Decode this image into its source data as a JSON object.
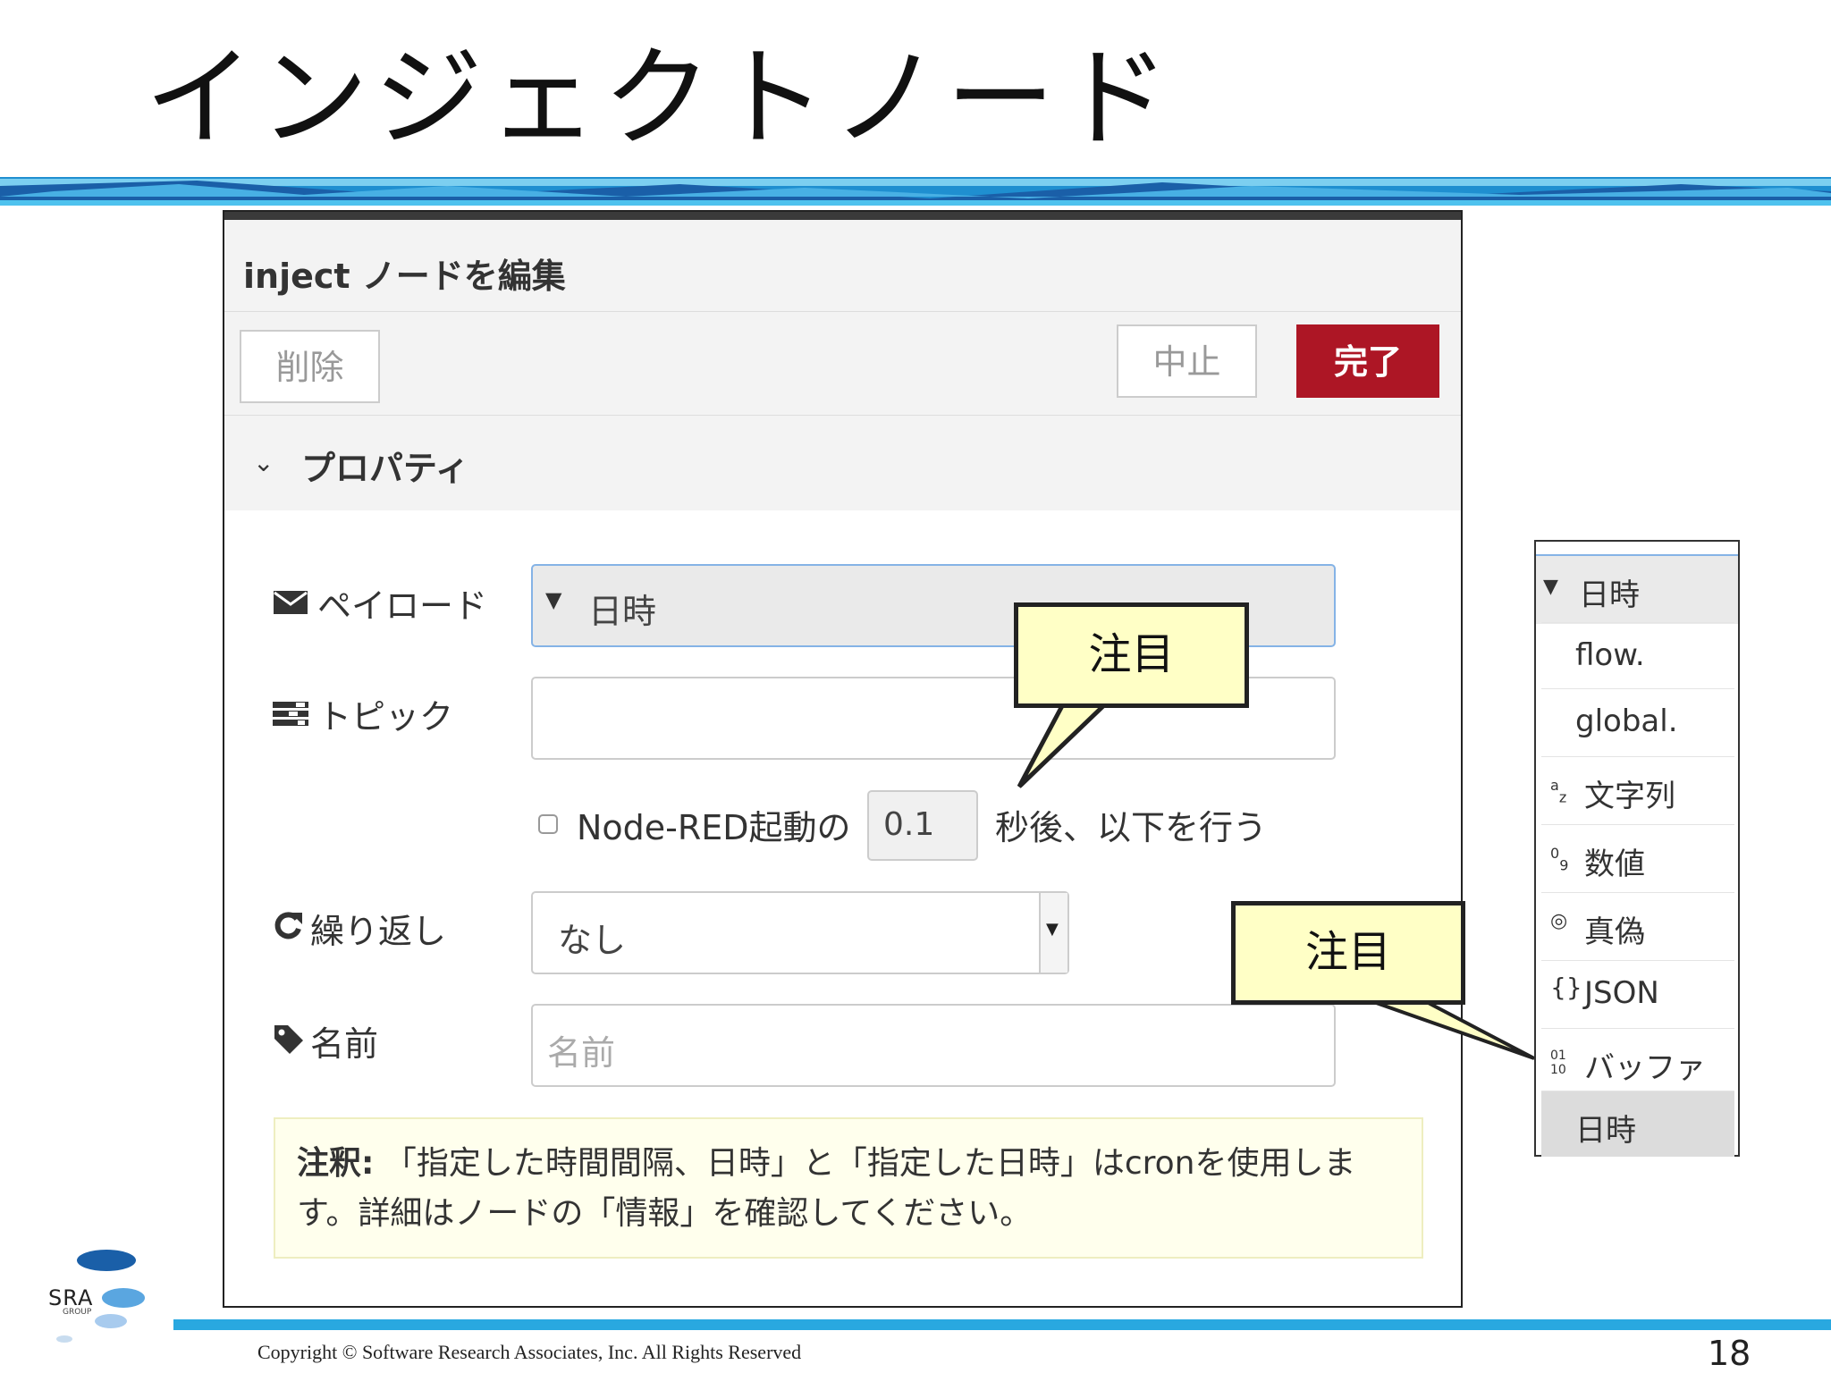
{
  "slide": {
    "title": "インジェクトノード",
    "copyright": "Copyright © Software Research Associates,  Inc. All Rights Reserved",
    "page_number": "18",
    "logo_text": "SRA",
    "logo_subtext": "GROUP"
  },
  "dialog": {
    "title": "inject ノードを編集",
    "delete_label": "削除",
    "cancel_label": "中止",
    "done_label": "完了",
    "section_label": "プロパティ",
    "payload": {
      "label": "ペイロード",
      "value": "日時"
    },
    "topic": {
      "label": "トピック",
      "value": ""
    },
    "once": {
      "label": "Node-RED起動の",
      "delay": "0.1",
      "suffix": "秒後、以下を行う",
      "checked": false
    },
    "repeat": {
      "label": "繰り返し",
      "value": "なし"
    },
    "name": {
      "label": "名前",
      "placeholder": "名前"
    },
    "note": {
      "strong": "注釈:",
      "text": " 「指定した時間間隔、日時」と「指定した日時」はcronを使用します。詳細はノードの「情報」を確認してください。"
    }
  },
  "callouts": [
    "注目",
    "注目"
  ],
  "type_menu": {
    "header": "日時",
    "items": [
      {
        "icon": "",
        "label": "flow."
      },
      {
        "icon": "a/z",
        "label": "global."
      },
      {
        "icon": "az",
        "label": "文字列"
      },
      {
        "icon": "09",
        "label": "数値"
      },
      {
        "icon": "◎",
        "label": "真偽"
      },
      {
        "icon": "{}",
        "label": "JSON"
      },
      {
        "icon": "01/10",
        "label": "バッファ"
      },
      {
        "icon": "",
        "label": "日時"
      }
    ]
  },
  "colors": {
    "done_button": "#ad1625",
    "callout_fill": "#ffffc6",
    "banner_blue": "#29a8e0",
    "note_fill": "#ffffed"
  }
}
